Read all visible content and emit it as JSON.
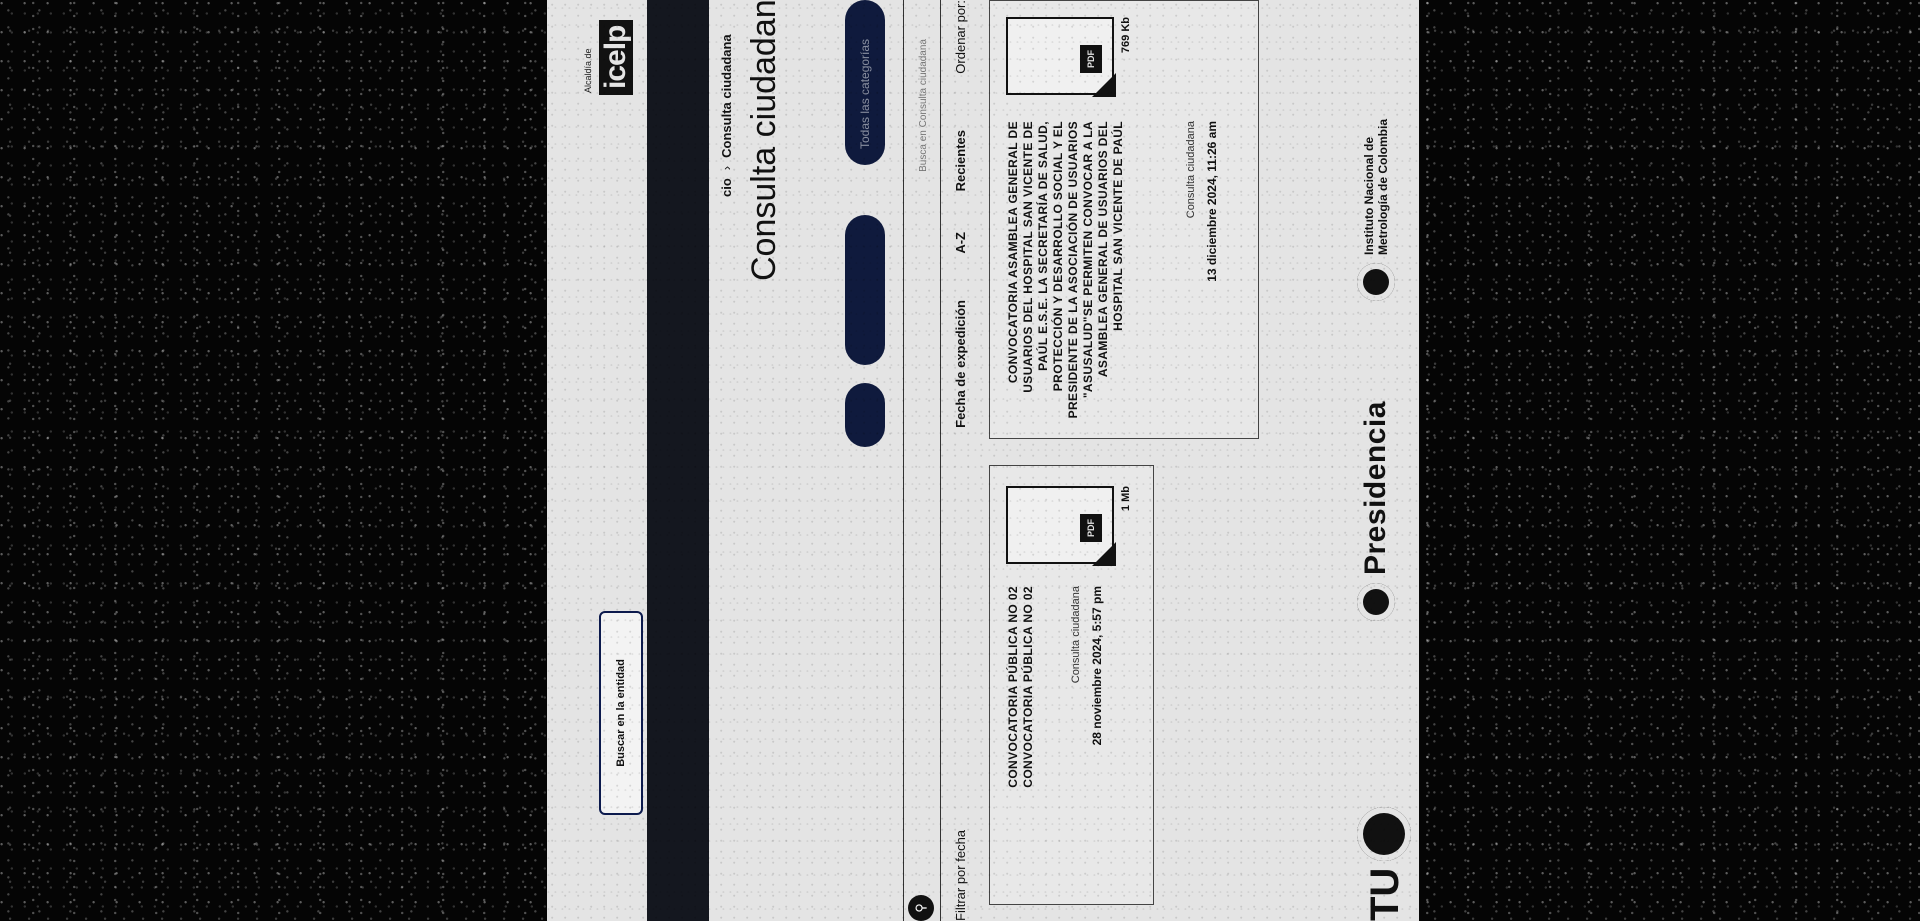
{
  "header": {
    "agency_logo_text": "icelp",
    "agency_logo_sub": "Alcaldía de",
    "search_entity_label": "Buscar en la entidad"
  },
  "breadcrumb": {
    "first": "cio",
    "separator": "›",
    "current": "Consulta ciudadana"
  },
  "page": {
    "title": "Consulta ciudadana",
    "categories_pill_label": "Todas las categorías"
  },
  "search": {
    "placeholder": "Busca en Consulta ciudadana"
  },
  "sort": {
    "label": "Ordenar por:",
    "options": [
      "Recientes",
      "A-Z",
      "Fecha de expedición"
    ],
    "filter_date_label": "Filtrar por fecha"
  },
  "cards": [
    {
      "title": "CONVOCATORIA ASAMBLEA GENERAL DE USUARIOS DEL HOSPITAL SAN VICENTE DE PAÚL E.S.E. LA SECRETARÍA DE SALUD, PROTECCIÓN Y DESARROLLO SOCIAL Y EL PRESIDENTE DE LA ASOCIACIÓN DE USUARIOS \"ASUSALUD\"SE PERMITEN CONVOCAR A LA ASAMBLEA GENERAL DE USUARIOS DEL HOSPITAL SAN VICENTE DE PAÚL",
      "category": "Consulta ciudadana",
      "date": "13 diciembre 2024, 11:26 am",
      "size": "769 Kb",
      "file_type": "PDF"
    },
    {
      "title": "CONVOCATORIA PÚBLICA NO 02 CONVOCATORIA PÚBLICA NO 02",
      "category": "Consulta ciudadana",
      "date": "28 noviembre 2024, 5:57 pm",
      "size": "1 Mb",
      "file_type": "PDF"
    }
  ],
  "footer": {
    "inm_name": "Instituto Nacional de Metrología de Colombia",
    "presidencia": "Presidencia",
    "tu": "TU"
  },
  "colors": {
    "page_bg": "#e4e4e4",
    "nav_bg": "#14171f",
    "pill_bg": "#0f1a3d",
    "outer_bg": "#050505"
  }
}
